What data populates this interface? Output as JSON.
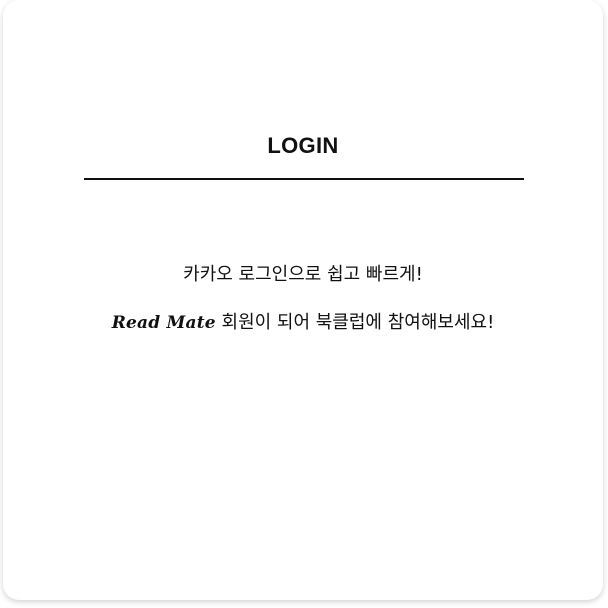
{
  "login": {
    "title": "LOGIN",
    "message_line1": "카카오 로그인으로 쉽고 빠르게!",
    "brand_name": "Read Mate",
    "message_line2_rest": " 회원이 되어 북클럽에 참여해보세요!"
  }
}
